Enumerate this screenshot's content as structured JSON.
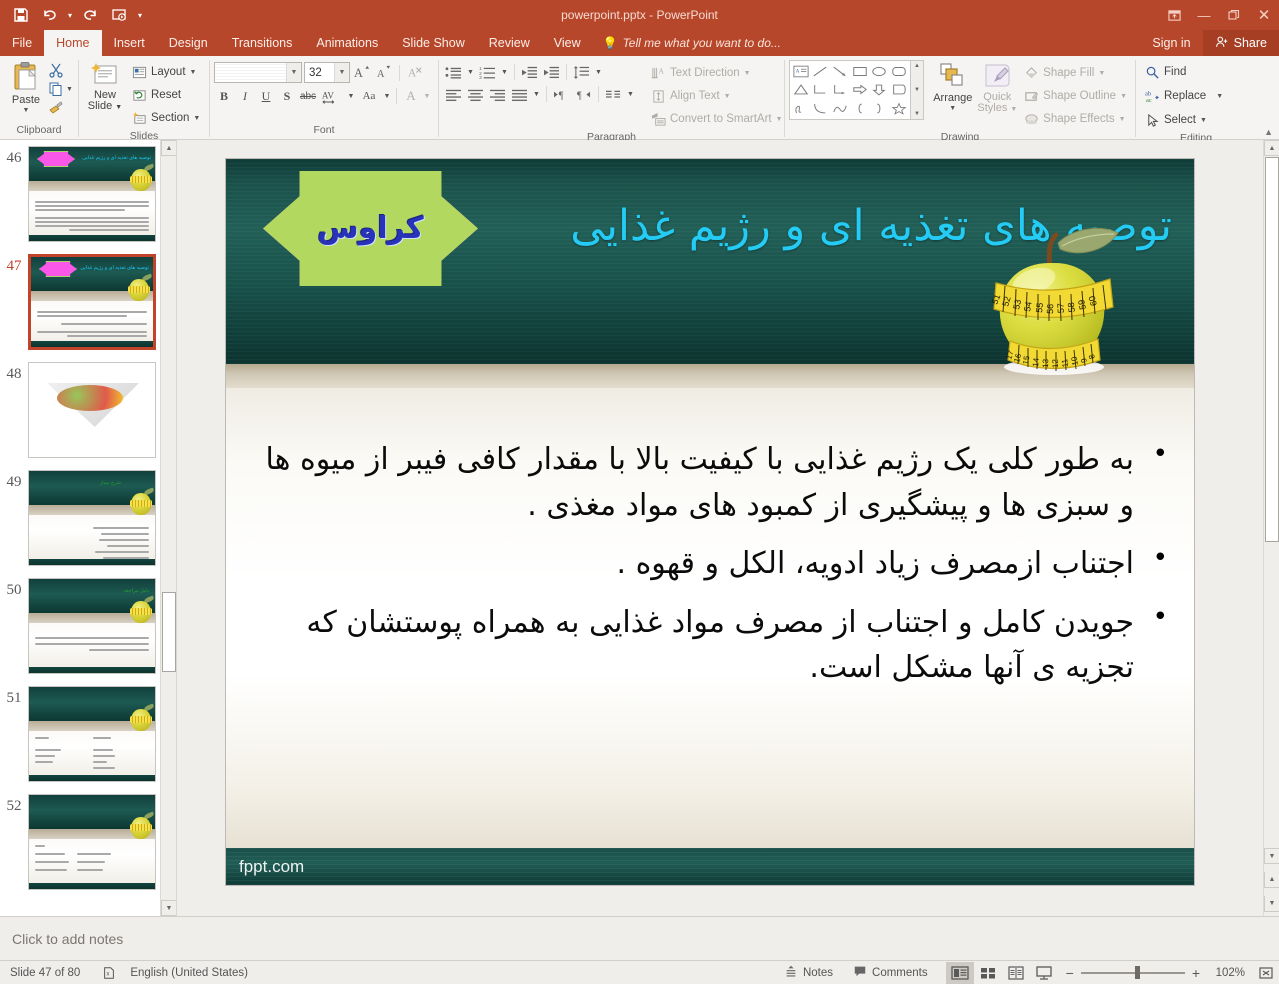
{
  "window": {
    "title": "powerpoint.pptx - PowerPoint",
    "quick_access": [
      "save-icon",
      "undo-icon",
      "redo-icon",
      "start-presentation-icon",
      "customize-qat-icon"
    ],
    "controls": [
      "ribbon-display-options-icon",
      "minimize-icon",
      "restore-icon",
      "close-icon"
    ]
  },
  "tabs": [
    {
      "label": "File",
      "active": false
    },
    {
      "label": "Home",
      "active": true
    },
    {
      "label": "Insert",
      "active": false
    },
    {
      "label": "Design",
      "active": false
    },
    {
      "label": "Transitions",
      "active": false
    },
    {
      "label": "Animations",
      "active": false
    },
    {
      "label": "Slide Show",
      "active": false
    },
    {
      "label": "Review",
      "active": false
    },
    {
      "label": "View",
      "active": false
    }
  ],
  "tell_me": "Tell me what you want to do...",
  "account": {
    "sign_in": "Sign in",
    "share": "Share"
  },
  "ribbon": {
    "clipboard": {
      "label": "Clipboard",
      "paste": "Paste",
      "items": [
        "cut-icon",
        "copy-icon",
        "format-painter-icon"
      ]
    },
    "slides": {
      "label": "Slides",
      "new_slide": "New\nSlide",
      "new_slide_line1": "New",
      "new_slide_line2": "Slide",
      "layout": "Layout",
      "reset": "Reset",
      "section": "Section"
    },
    "font": {
      "label": "Font",
      "font_name": "",
      "font_size": "32",
      "buttons": [
        "bold",
        "italic",
        "underline",
        "shadow",
        "strikethrough",
        "character-spacing",
        "change-case",
        "font-color"
      ]
    },
    "paragraph": {
      "label": "Paragraph",
      "text_direction": "Text Direction",
      "align_text": "Align Text",
      "convert_to_smartart": "Convert to SmartArt"
    },
    "drawing": {
      "label": "Drawing",
      "arrange": "Arrange",
      "quick_styles_line1": "Quick",
      "quick_styles_line2": "Styles",
      "shape_fill": "Shape Fill",
      "shape_outline": "Shape Outline",
      "shape_effects": "Shape Effects"
    },
    "editing": {
      "label": "Editing",
      "find": "Find",
      "replace": "Replace",
      "select": "Select"
    }
  },
  "thumbnails": [
    {
      "number": "46",
      "selected": false,
      "kind": "title-bullets"
    },
    {
      "number": "47",
      "selected": true,
      "kind": "title-bullets"
    },
    {
      "number": "48",
      "selected": false,
      "kind": "image"
    },
    {
      "number": "49",
      "selected": false,
      "kind": "text-right"
    },
    {
      "number": "50",
      "selected": false,
      "kind": "text-right"
    },
    {
      "number": "51",
      "selected": false,
      "kind": "two-column"
    },
    {
      "number": "52",
      "selected": false,
      "kind": "text-left"
    }
  ],
  "slide": {
    "badge_text": "کراوس",
    "title": "توصیه های تغذیه ای و رژیم غذایی",
    "bullets": [
      "به طور کلی یک رژیم غذایی با کیفیت بالا با مقدار کافی فیبر از میوه ها و سبزی ها و پیشگیری از کمبود های مواد مغذی .",
      "اجتناب ازمصرف زیاد ادویه، الکل و قهوه .",
      "جویدن کامل و اجتناب از مصرف مواد غذایی به همراه پوستشان که تجزیه ی آنها مشکل است."
    ],
    "footer": "fppt.com",
    "apple_tape_top": [
      "51",
      "52",
      "53",
      "54",
      "55",
      "56",
      "57",
      "58",
      "59",
      "60"
    ],
    "apple_tape_bottom": [
      "17",
      "16",
      "15",
      "14",
      "13",
      "12",
      "11",
      "10",
      "9",
      "8"
    ]
  },
  "notes": {
    "placeholder": "Click to add notes"
  },
  "status": {
    "slide_counter": "Slide 47 of 80",
    "language": "English (United States)",
    "notes_button": "Notes",
    "comments_button": "Comments",
    "zoom_level": "102%",
    "views": [
      "normal-view-icon",
      "slide-sorter-icon",
      "reading-view-icon",
      "slide-show-icon"
    ]
  },
  "colors": {
    "brand": "#b7472a",
    "ribbon_bg": "#f5f4f2",
    "slide_dark": "#1b524b",
    "title_cyan": "#24ccf5",
    "badge_pink": "#f758ea",
    "badge_outline": "#b3d85f",
    "selection_red": "#c0432a"
  }
}
